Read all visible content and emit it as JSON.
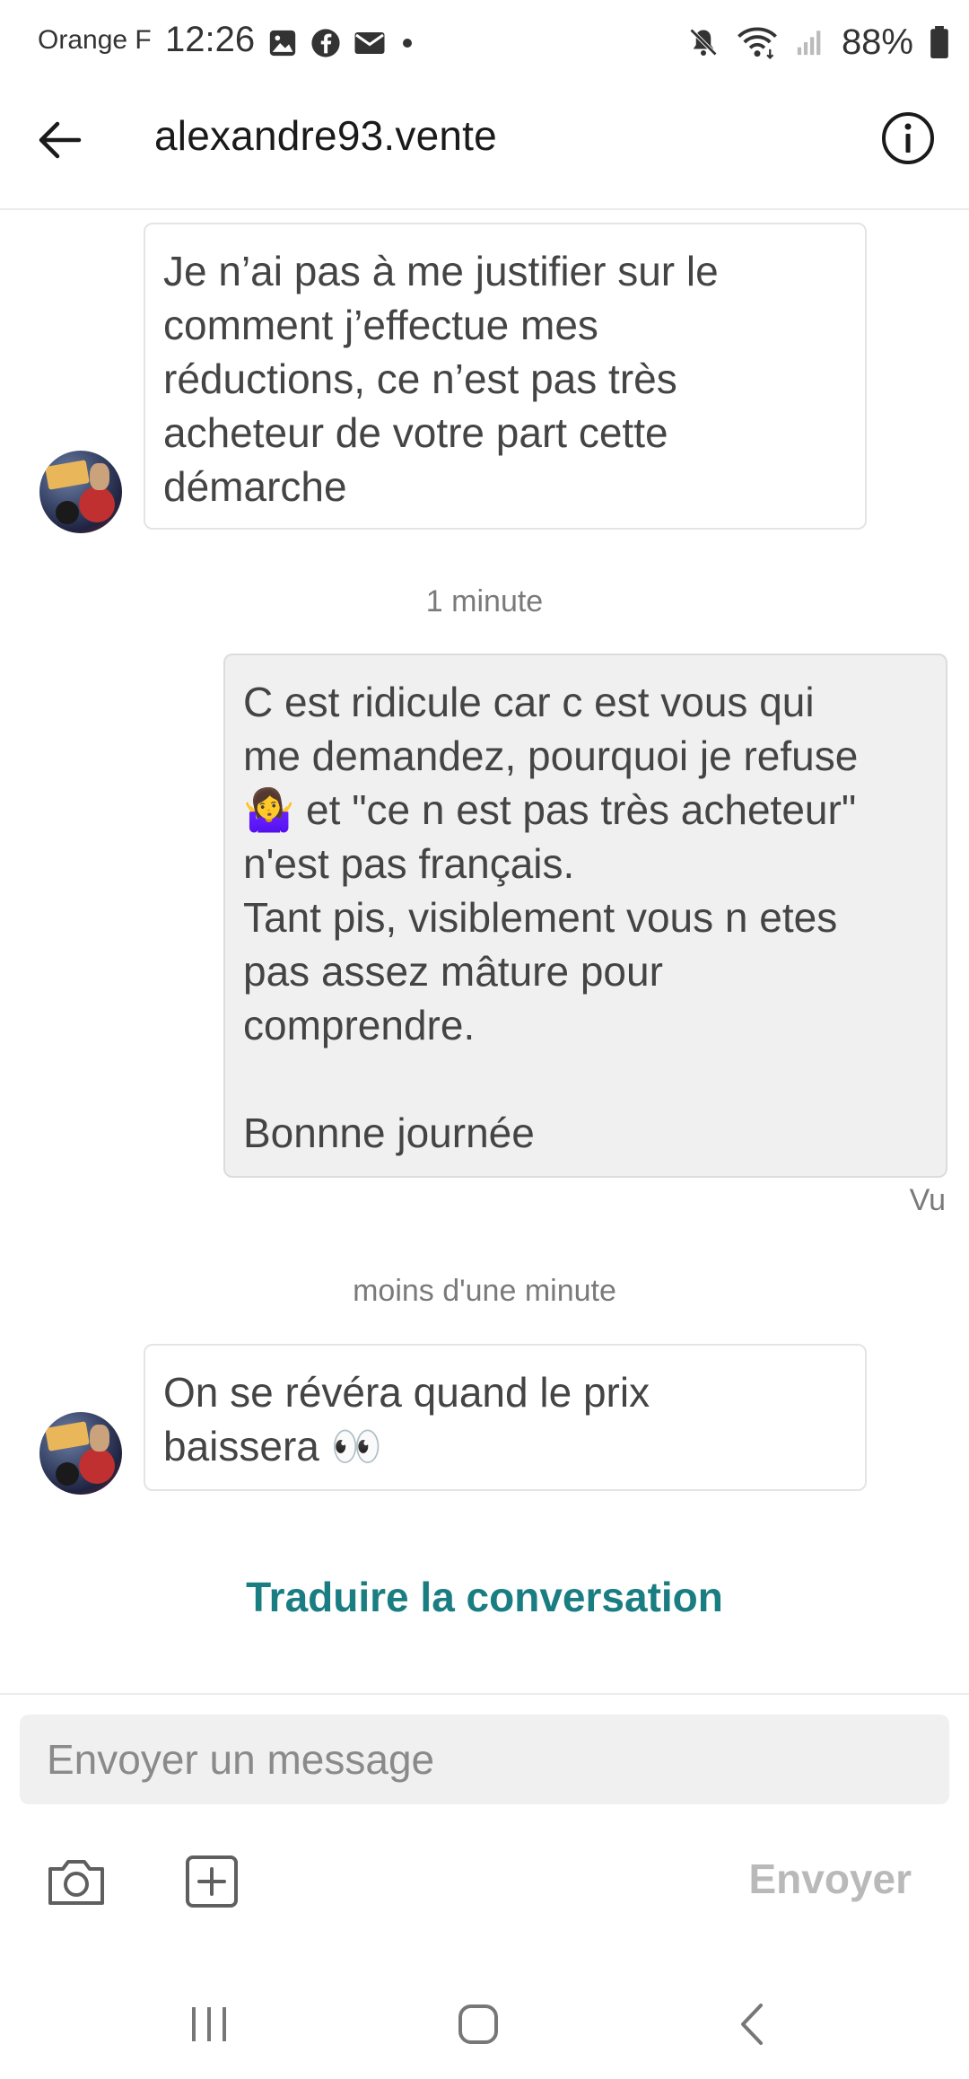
{
  "status_bar": {
    "carrier": "Orange F",
    "time": "12:26",
    "notification_icons": [
      "image-icon",
      "facebook-icon",
      "mail-icon",
      "dot-icon"
    ],
    "system_icons": [
      "mute-icon",
      "wifi-icon",
      "signal-icon",
      "battery-icon"
    ],
    "battery": "88%"
  },
  "header": {
    "title": "alexandre93.vente",
    "back_icon": "arrow-left-icon",
    "info_icon": "info-icon"
  },
  "messages": [
    {
      "sender": "other",
      "text": "Je n’ai pas à me justifier sur le\ncomment j’effectue mes\nréductions, ce n’est pas très\nacheteur de votre part cette\ndémarche"
    },
    {
      "sender": "me",
      "text": "C est ridicule car c est vous qui\nme demandez, pourquoi je refuse\n🤷‍♀️ et \"ce n est pas très acheteur\"\nn'est pas français.\nTant pis, visiblement vous n etes\npas assez mâture pour\ncomprendre.\n\nBonnne journée"
    },
    {
      "sender": "other",
      "text": "On se révéra quand le prix\nbaissera 👀"
    }
  ],
  "timestamps": {
    "first": "1 minute",
    "second": "moins d'une minute"
  },
  "seen_label": "Vu",
  "translate_label": "Traduire la conversation",
  "composer": {
    "placeholder": "Envoyer un message",
    "value": "",
    "send_label": "Envoyer",
    "camera_icon": "camera-icon",
    "add_icon": "add-square-icon"
  },
  "nav_bar": {
    "icons": [
      "recent-apps-icon",
      "home-icon",
      "back-icon"
    ]
  },
  "colors": {
    "accent": "#1a7d82",
    "own_bubble": "#f0f0f0",
    "send_disabled": "#b9b9b9"
  }
}
